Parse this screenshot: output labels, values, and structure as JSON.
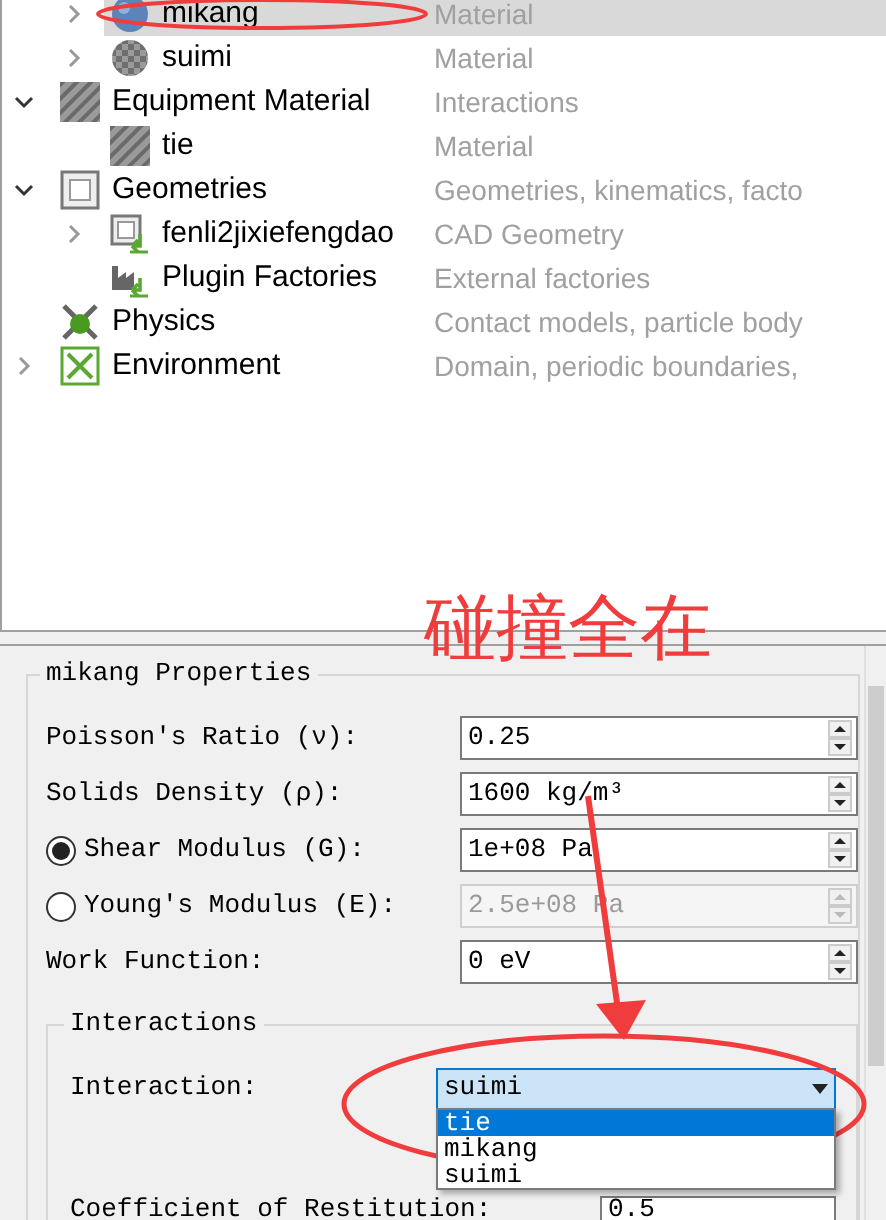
{
  "tree": {
    "continued_children": [
      {
        "label": "mikang",
        "description": "Material",
        "kind": "sphere",
        "expanded": false,
        "selected": true
      },
      {
        "label": "suimi",
        "description": "Material",
        "kind": "checkered",
        "expanded": false,
        "selected": false
      }
    ],
    "items": [
      {
        "label": "Equipment Material",
        "description": "Interactions",
        "kind": "hatched",
        "expanded": true,
        "selected": false,
        "children": [
          {
            "label": "tie",
            "description": "Material",
            "kind": "hatched",
            "selected": false
          }
        ]
      },
      {
        "label": "Geometries",
        "description": "Geometries, kinematics, facto",
        "kind": "frame",
        "expanded": true,
        "selected": false,
        "children": [
          {
            "label": "fenli2jixiefengdao",
            "description": "CAD Geometry",
            "kind": "import",
            "expanded": false,
            "selected": false
          },
          {
            "label": "Plugin Factories",
            "description": "External factories",
            "kind": "factory",
            "selected": false
          }
        ]
      },
      {
        "label": "Physics",
        "description": "Contact models, particle body",
        "kind": "physics",
        "selected": false
      },
      {
        "label": "Environment",
        "description": "Domain, periodic boundaries,",
        "kind": "environment",
        "expanded": false,
        "selected": false
      }
    ]
  },
  "annotation_text": "碰撞全在",
  "properties": {
    "title": "mikang Properties",
    "fields": [
      {
        "kind": "spin",
        "label": "Poisson's Ratio (ν):",
        "value": "0.25",
        "disabled": false
      },
      {
        "kind": "spin",
        "label": "Solids Density (ρ):",
        "value": "1600 kg/m³",
        "disabled": false
      },
      {
        "kind": "radio",
        "label": "Shear Modulus (G):",
        "value": "1e+08 Pa",
        "selected": true,
        "disabled": false
      },
      {
        "kind": "radio",
        "label": "Young's Modulus (E):",
        "value": "2.5e+08 Pa",
        "selected": false,
        "disabled": true
      },
      {
        "kind": "spin",
        "label": "Work Function:",
        "value": "0 eV",
        "disabled": false
      }
    ],
    "interactions": {
      "title": "Interactions",
      "interaction_label": "Interaction:",
      "combo_value": "suimi",
      "options": [
        {
          "label": "tie",
          "selected": true
        },
        {
          "label": "mikang",
          "selected": false
        },
        {
          "label": "suimi",
          "selected": false
        }
      ],
      "coefficient_label": "Coefficient of Restitution:",
      "coefficient_value": "0.5"
    }
  }
}
